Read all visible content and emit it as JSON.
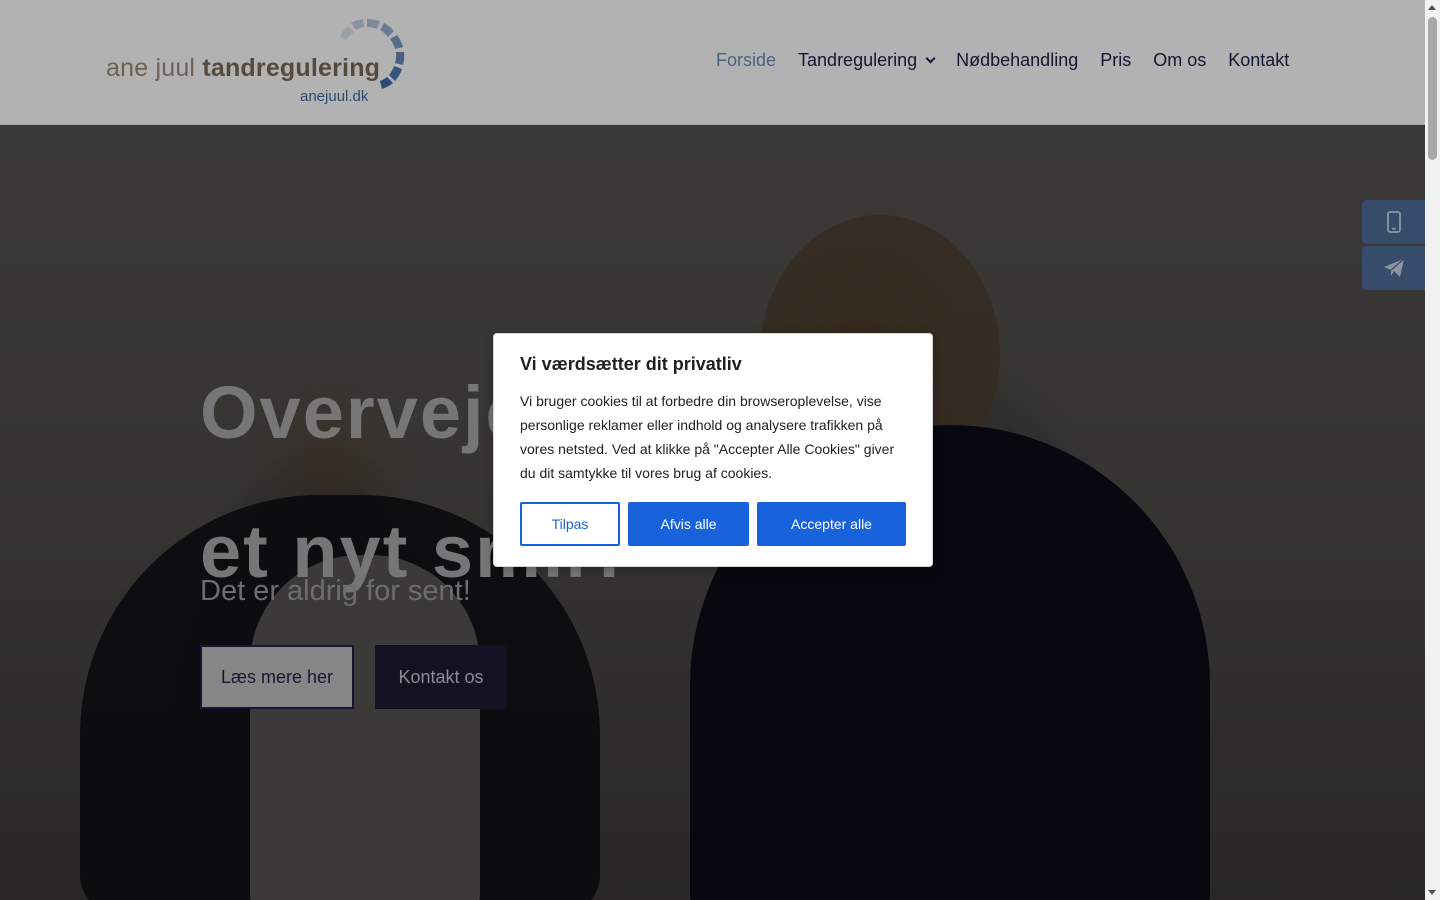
{
  "header": {
    "logo": {
      "light_text": "ane juul ",
      "bold_text": "tandregulering",
      "domain": "anejuul.dk"
    },
    "nav": [
      {
        "label": "Forside",
        "active": true
      },
      {
        "label": "Tandregulering",
        "has_dropdown": true
      },
      {
        "label": "Nødbehandling"
      },
      {
        "label": "Pris"
      },
      {
        "label": "Om os"
      },
      {
        "label": "Kontakt"
      }
    ]
  },
  "hero": {
    "title": "Overvejer du\net nyt smil?",
    "subtitle": "Det er aldrig for sent!",
    "buttons": {
      "read_more": "Læs mere her",
      "contact": "Kontakt os"
    }
  },
  "side_buttons": [
    {
      "icon": "phone-icon"
    },
    {
      "icon": "paper-plane-icon"
    }
  ],
  "cookie_banner": {
    "title": "Vi værdsætter dit privatliv",
    "text": "Vi bruger cookies til at forbedre din browseroplevelse, vise personlige reklamer eller indhold og analysere trafikken på vores netsted. Ved at klikke på \"Accepter Alle Cookies\" giver du dit samtykke til vores brug af cookies.",
    "buttons": {
      "customize": "Tilpas",
      "reject": "Afvis alle",
      "accept": "Accepter alle"
    }
  },
  "colors": {
    "nav_text": "#1e2248",
    "nav_active": "#6b8ebf",
    "cookie_primary": "#1863dc",
    "side_button": "#4e6e98"
  }
}
